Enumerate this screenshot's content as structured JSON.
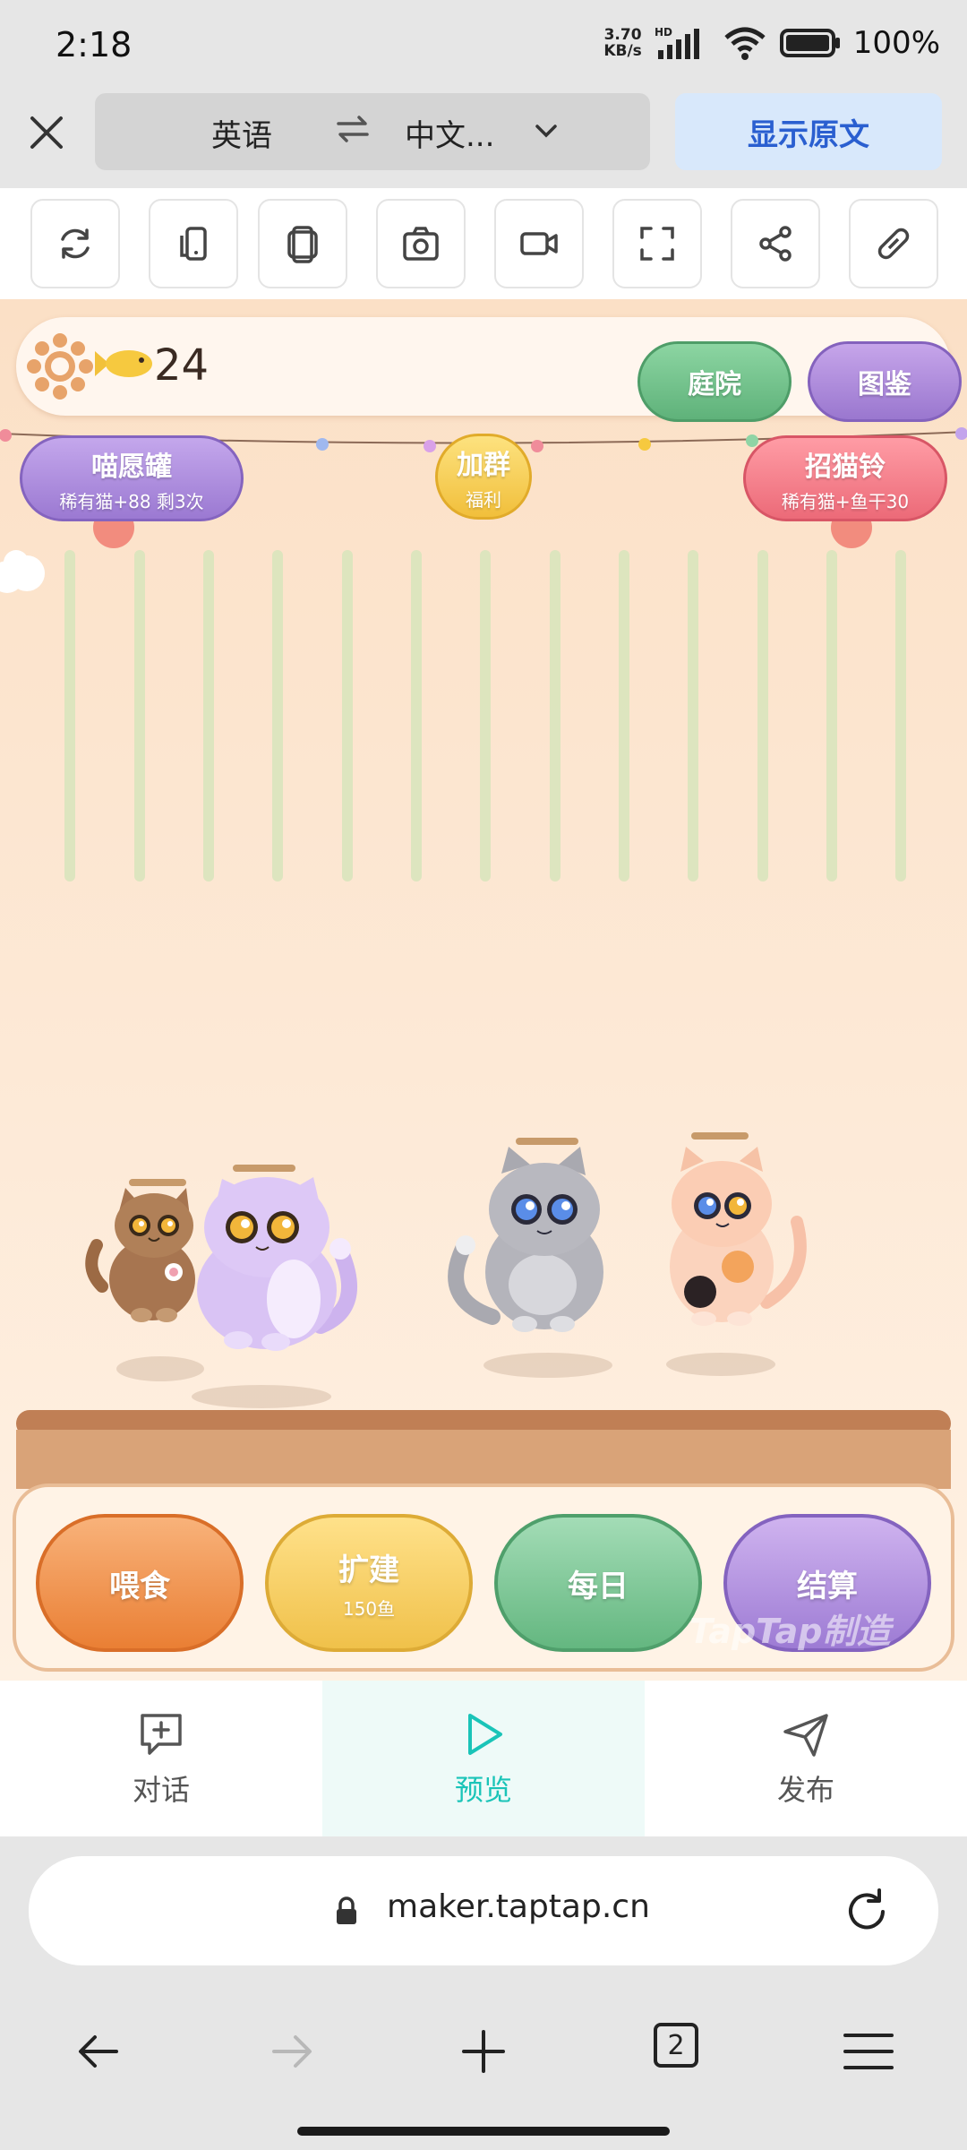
{
  "status": {
    "time": "2:18",
    "net_speed_value": "3.70",
    "net_speed_unit": "KB/s",
    "signal_label": "HD",
    "battery": "100%"
  },
  "translate_bar": {
    "source_lang": "英语",
    "target_lang": "中文...",
    "show_original": "显示原文"
  },
  "toolbar": {
    "icons": [
      "refresh-icon",
      "rotate-device-icon",
      "duplicate-icon",
      "camera-icon",
      "video-icon",
      "fullscreen-icon",
      "share-icon",
      "link-icon"
    ]
  },
  "game": {
    "fish_count": "24",
    "courtyard": "庭院",
    "album": "图鉴",
    "wish_jar": {
      "title": "喵愿罐",
      "sub": "稀有猫+88 剩3次"
    },
    "join_group": {
      "title": "加群",
      "sub": "福利"
    },
    "cat_bell": {
      "title": "招猫铃",
      "sub": "稀有猫+鱼干30"
    },
    "actions": {
      "feed": "喂食",
      "build": "扩建",
      "build_sub": "150鱼",
      "daily": "每日",
      "settle": "结算"
    },
    "watermark": "TapTap制造"
  },
  "bottom_tabs": {
    "chat": "对话",
    "preview": "预览",
    "publish": "发布",
    "active": "预览",
    "accent": "#1ac4b8"
  },
  "browser": {
    "url": "maker.taptap.cn",
    "tab_count": "2"
  }
}
